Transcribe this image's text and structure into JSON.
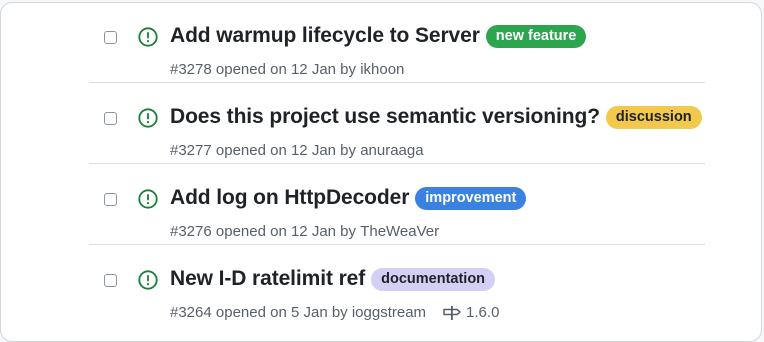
{
  "colors": {
    "open_icon": "#1a7f37",
    "label_new_feature_bg": "#2da44e",
    "label_new_feature_fg": "#ffffff",
    "label_discussion_bg": "#f2c94c",
    "label_discussion_fg": "#1f2328",
    "label_improvement_bg": "#3b82e0",
    "label_improvement_fg": "#ffffff",
    "label_documentation_bg": "#d4cff5",
    "label_documentation_fg": "#1f2328"
  },
  "issues": [
    {
      "title": "Add warmup lifecycle to Server",
      "label": "new feature",
      "number": "#3278",
      "opened_text": "opened on 12 Jan by",
      "author": "ikhoon",
      "status_icon": "issue-opened-icon"
    },
    {
      "title": "Does this project use semantic versioning?",
      "label": "discussion",
      "number": "#3277",
      "opened_text": "opened on 12 Jan by",
      "author": "anuraaga",
      "status_icon": "issue-opened-icon"
    },
    {
      "title": "Add log on HttpDecoder",
      "label": "improvement",
      "number": "#3276",
      "opened_text": "opened on 12 Jan by",
      "author": "TheWeaVer",
      "status_icon": "issue-opened-icon"
    },
    {
      "title": "New I-D ratelimit ref",
      "label": "documentation",
      "number": "#3264",
      "opened_text": "opened on 5 Jan by",
      "author": "ioggstream",
      "milestone": "1.6.0",
      "milestone_icon": "milestone-icon",
      "status_icon": "issue-opened-icon"
    }
  ]
}
